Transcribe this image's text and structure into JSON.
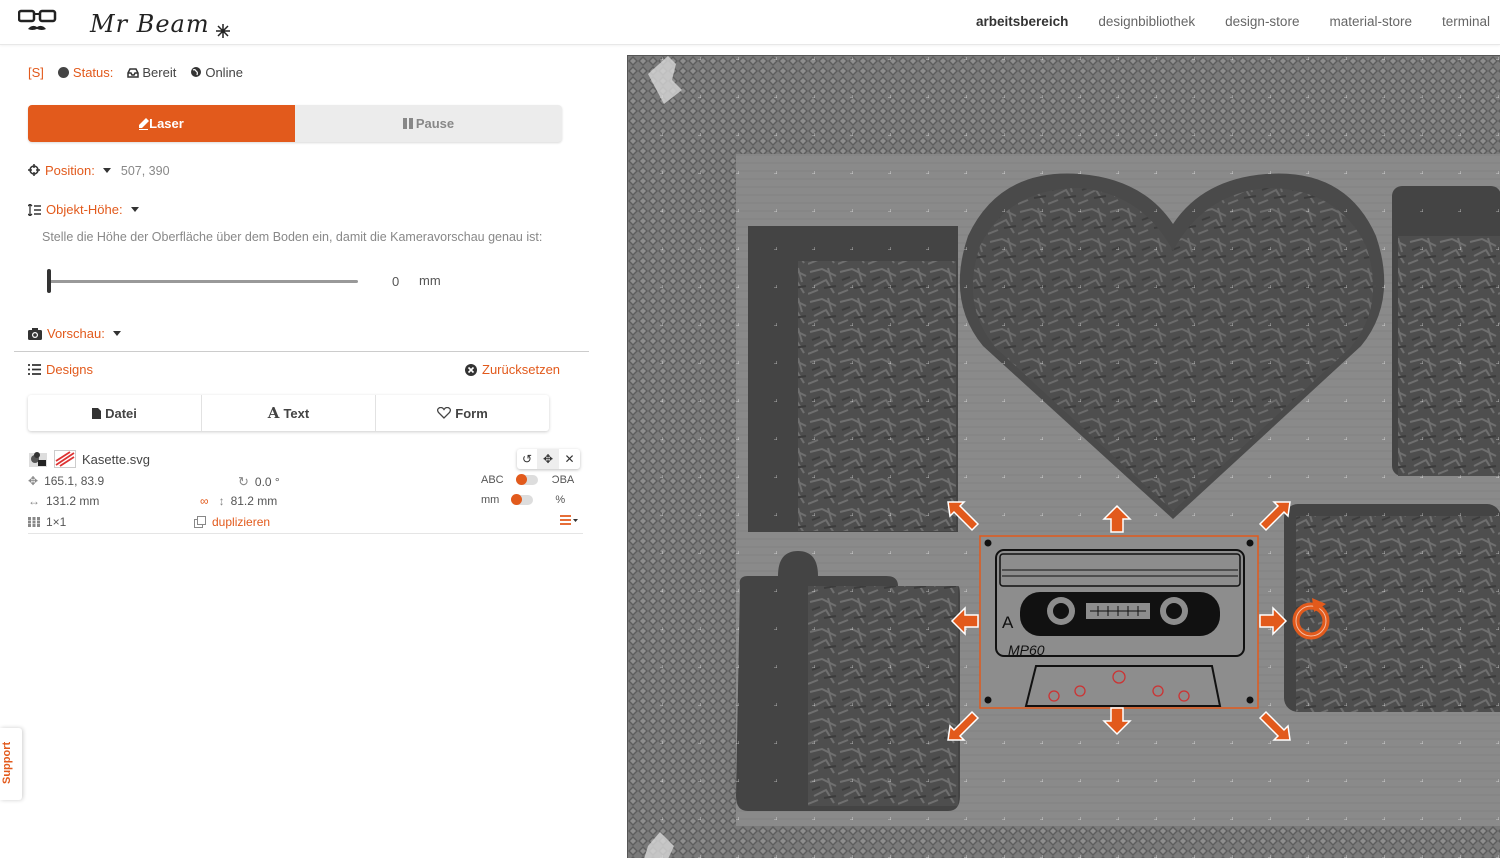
{
  "header": {
    "logo_text": "Mr Beam",
    "nav": [
      "arbeitsbereich",
      "designbibliothek",
      "design-store",
      "material-store",
      "terminal"
    ],
    "active_index": 0
  },
  "status": {
    "shortcut": "[S]",
    "label": "Status:",
    "state": "Bereit",
    "connection": "Online"
  },
  "mode": {
    "laser": "Laser",
    "pause": "Pause"
  },
  "position": {
    "label": "Position:",
    "value": "507, 390"
  },
  "height": {
    "label": "Objekt-Höhe:",
    "description": "Stelle die Höhe der Oberfläche über dem Boden ein, damit die Kameravorschau genau ist:",
    "value": "0",
    "unit": "mm",
    "slider_fraction": 0
  },
  "preview": {
    "label": "Vorschau:"
  },
  "designs": {
    "label": "Designs",
    "reset": "Zurücksetzen",
    "add_buttons": {
      "file": "Datei",
      "text": "Text",
      "shape": "Form"
    }
  },
  "item": {
    "name": "Kasette.svg",
    "position": "165.1, 83.9",
    "rotation": "0.0 °",
    "width": "131.2 mm",
    "height": "81.2 mm",
    "grid": "1×1",
    "duplicate": "duplizieren",
    "mirror_left": "ABC",
    "mirror_right": "ƆBA",
    "unit_left": "mm",
    "unit_right": "%"
  },
  "support": "Support",
  "cassette": {
    "side": "A",
    "model": "MP60"
  },
  "colors": {
    "accent": "#e25a1c",
    "workarea": "#7c7c7c"
  }
}
